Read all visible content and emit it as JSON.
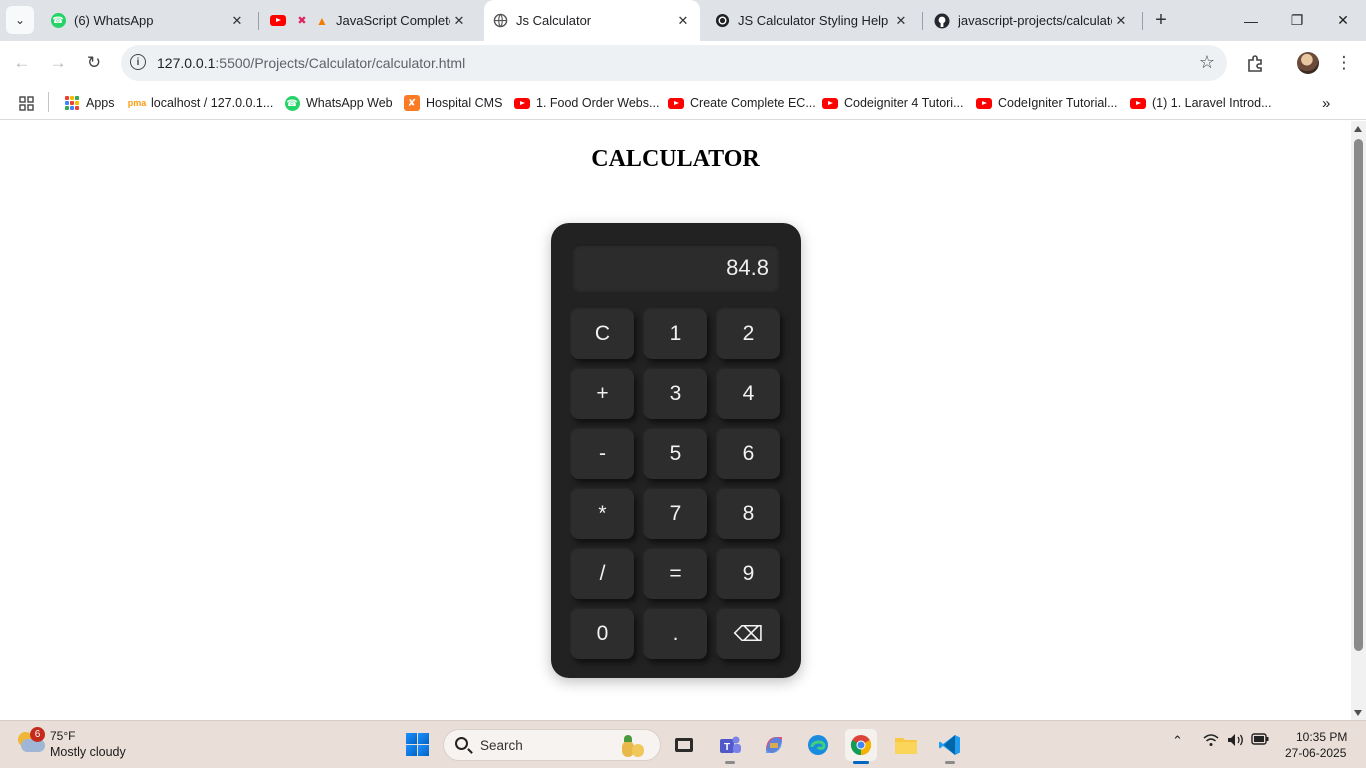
{
  "browser": {
    "tabs": [
      {
        "title": "(6) WhatsApp",
        "icon": "whatsapp-icon"
      },
      {
        "title": "JavaScript Complete",
        "icon": "youtube-icon"
      },
      {
        "title": "Js Calculator",
        "icon": "globe-icon"
      },
      {
        "title": "JS Calculator Styling Help",
        "icon": "chatgpt-icon"
      },
      {
        "title": "javascript-projects/calculator",
        "icon": "github-icon"
      }
    ],
    "active_tab_index": 2,
    "url_host": "127.0.0.1",
    "url_path": ":5500/Projects/Calculator/calculator.html"
  },
  "bookmarks": [
    {
      "label": "Apps",
      "icon": "apps-grid-icon"
    },
    {
      "label": "localhost / 127.0.0.1...",
      "icon": "phpmyadmin-icon"
    },
    {
      "label": "WhatsApp Web",
      "icon": "whatsapp-icon"
    },
    {
      "label": "Hospital CMS",
      "icon": "xampp-icon"
    },
    {
      "label": "1. Food Order Webs...",
      "icon": "youtube-icon"
    },
    {
      "label": "Create Complete EC...",
      "icon": "youtube-icon"
    },
    {
      "label": "Codeigniter 4 Tutori...",
      "icon": "youtube-icon"
    },
    {
      "label": "CodeIgniter Tutorial...",
      "icon": "youtube-icon"
    },
    {
      "label": "(1) 1. Laravel Introd...",
      "icon": "youtube-icon"
    }
  ],
  "page": {
    "title": "CALCULATOR",
    "display_value": "84.8",
    "keys": [
      "C",
      "1",
      "2",
      "+",
      "3",
      "4",
      "-",
      "5",
      "6",
      "*",
      "7",
      "8",
      "/",
      "=",
      "9",
      "0",
      ".",
      "⌫"
    ]
  },
  "taskbar": {
    "weather_badge": "6",
    "weather_temp": "75°F",
    "weather_desc": "Mostly cloudy",
    "search_label": "Search",
    "time": "10:35 PM",
    "date": "27-06-2025"
  },
  "colors": {
    "calc_body": "#222222",
    "calc_key": "#2d2d2d",
    "calc_display": "#2c2c2c",
    "active_accent": "#0067c0"
  }
}
